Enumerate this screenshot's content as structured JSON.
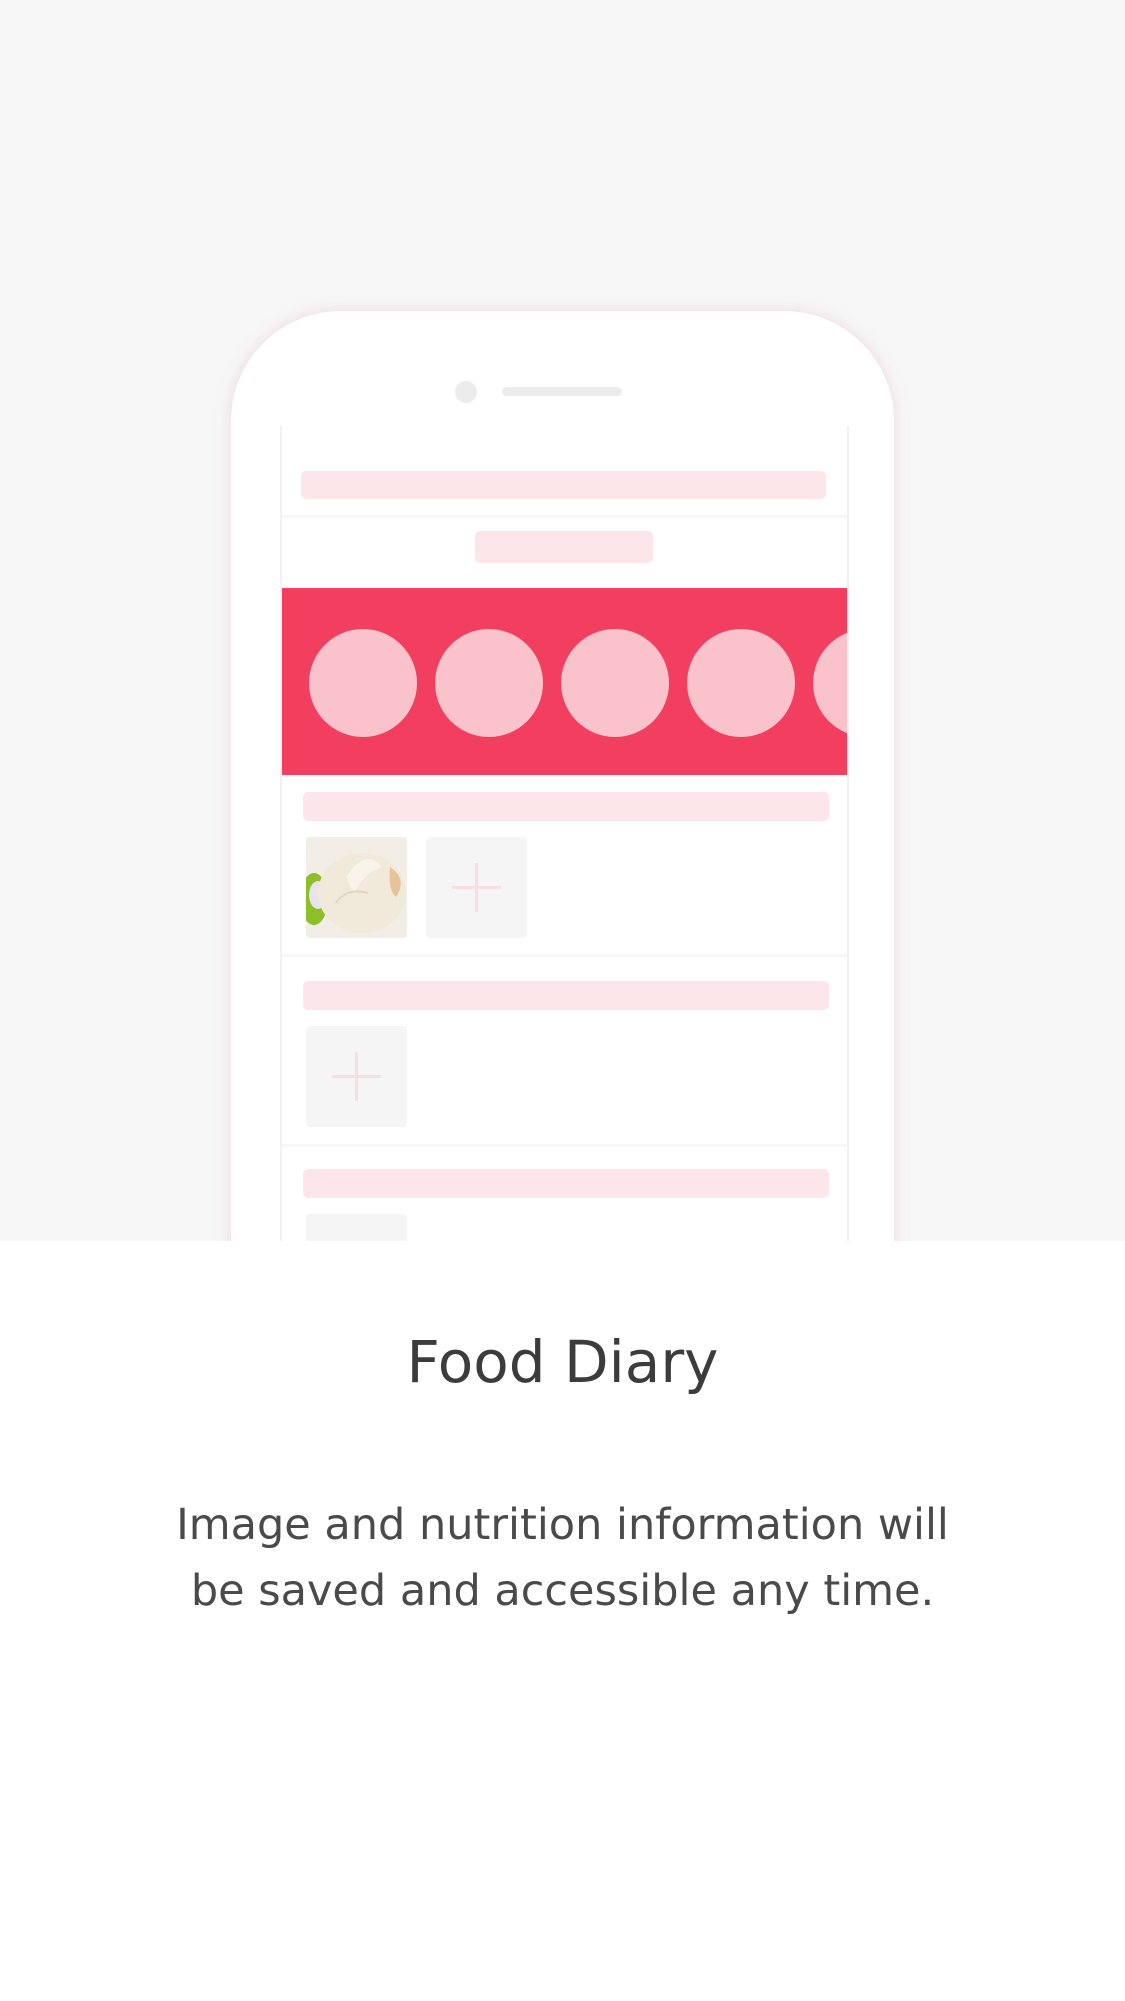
{
  "onboarding": {
    "title": "Food Diary",
    "description": "Image and nutrition information will be saved and accessible any time."
  },
  "illustration": {
    "device": "phone",
    "banner_color": "#f23f60",
    "placeholder_color": "#fde6ea",
    "circle_color": "#fac2cb",
    "icons": [
      "plus-icon",
      "food-photo"
    ]
  }
}
